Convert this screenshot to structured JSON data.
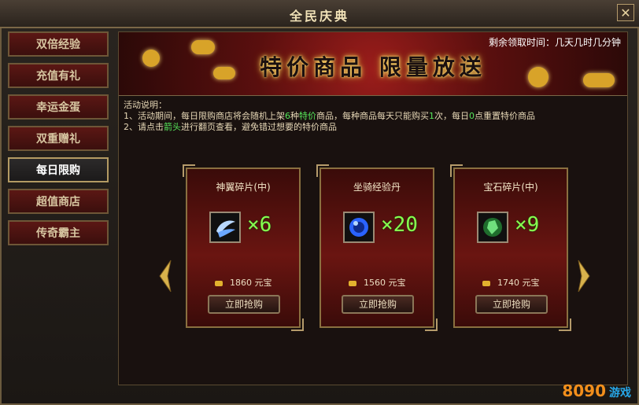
{
  "window": {
    "title": "全民庆典",
    "close_label": "✕"
  },
  "sidebar": {
    "items": [
      {
        "label": "双倍经验",
        "active": false
      },
      {
        "label": "充值有礼",
        "active": false
      },
      {
        "label": "幸运金蛋",
        "active": false
      },
      {
        "label": "双重赠礼",
        "active": false
      },
      {
        "label": "每日限购",
        "active": true
      },
      {
        "label": "超值商店",
        "active": false
      },
      {
        "label": "传奇霸主",
        "active": false
      }
    ]
  },
  "banner": {
    "remaining_label": "剩余领取时间：几天几时几分钟",
    "headline": "特价商品    限量放送"
  },
  "description": {
    "heading": "活动说明：",
    "line1_parts": [
      "1、活动期间，每日限购商店将会随机上架",
      "6",
      "种",
      "特价",
      "商品，每种商品每天只能购买",
      "1",
      "次，每日",
      "0",
      "点重置特价商品"
    ],
    "line2_parts": [
      "2、请点击",
      "箭头",
      "进行翻页查看，避免错过想要的特价商品"
    ]
  },
  "cards": [
    {
      "name": "神翼碎片(中)",
      "qty": "×6",
      "price": "1860",
      "currency": "元宝",
      "buy_label": "立即抢购",
      "icon": "wing-shard-icon"
    },
    {
      "name": "坐骑经验丹",
      "qty": "×20",
      "price": "1560",
      "currency": "元宝",
      "buy_label": "立即抢购",
      "icon": "mount-exp-pill-icon"
    },
    {
      "name": "宝石碎片(中)",
      "qty": "×9",
      "price": "1740",
      "currency": "元宝",
      "buy_label": "立即抢购",
      "icon": "gem-shard-icon"
    }
  ],
  "watermark": {
    "brand": "8090",
    "suffix": "游戏"
  },
  "colors": {
    "accent_green": "#56e55a",
    "quantity_green": "#86ff4f",
    "gold": "#e2b12e",
    "frame_gold": "#8a7040"
  }
}
